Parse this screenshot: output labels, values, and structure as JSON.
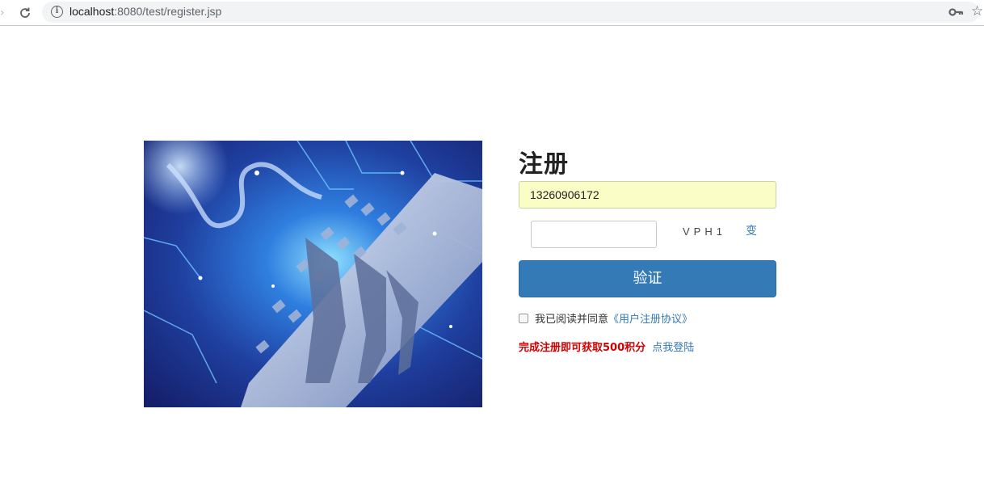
{
  "browser": {
    "url_host": "localhost",
    "url_path": ":8080/test/register.jsp",
    "icons": [
      "forward-icon",
      "reload-icon",
      "info-icon",
      "key-icon",
      "star-icon"
    ]
  },
  "form": {
    "title": "注册",
    "phone_value": "13260906172",
    "captcha_code": "VPH1",
    "captcha_change": "变",
    "verify_label": "验证",
    "agree_text": "我已阅读并同意",
    "agree_link": "《用户注册协议》",
    "bonus_text": "完成注册即可获取500积分",
    "login_link": "点我登陆"
  },
  "colors": {
    "primary": "#337ab7",
    "highlight_red": "#d40000",
    "autofill_bg": "#fbfdc6"
  }
}
